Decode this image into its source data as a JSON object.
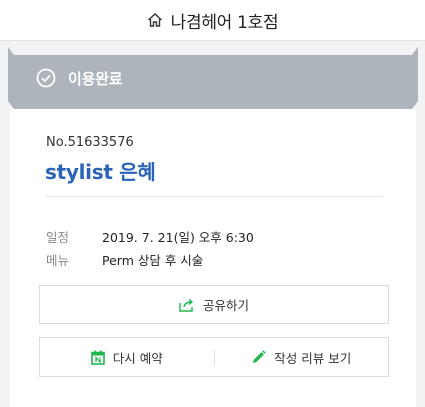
{
  "header": {
    "title": "나겸헤어 1호점",
    "icon": "home-icon"
  },
  "status": {
    "label": "이용완료",
    "icon": "check-circle-icon",
    "color": "#aeb4bc"
  },
  "reservation": {
    "number": "No.51633576",
    "stylist": "stylist 은혜",
    "details": [
      {
        "key": "일정",
        "value": "2019. 7. 21(일) 오후 6:30"
      },
      {
        "key": "메뉴",
        "value": "Perm 상담 후 시술"
      }
    ]
  },
  "actions": {
    "share_label": "공유하기",
    "rebook_label": "다시 예약",
    "reviews_label": "작성 리뷰 보기"
  },
  "colors": {
    "accent": "#2b63b8",
    "icon_green": "#1fb84f"
  }
}
